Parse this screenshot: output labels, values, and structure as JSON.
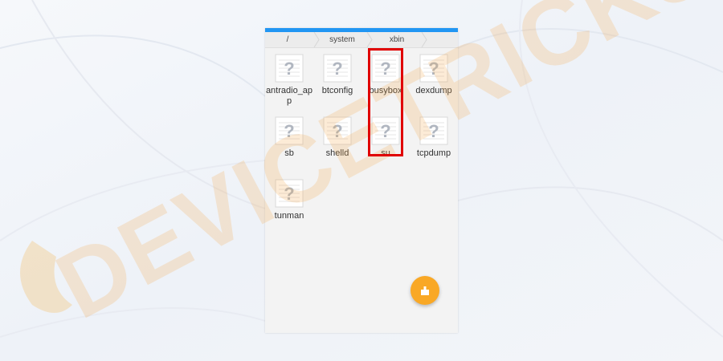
{
  "breadcrumb": [
    "/",
    "system",
    "xbin"
  ],
  "files": [
    {
      "name": "antradio_app",
      "icon": "unknown-file-icon"
    },
    {
      "name": "btconfig",
      "icon": "unknown-file-icon"
    },
    {
      "name": "busybox",
      "icon": "unknown-file-icon"
    },
    {
      "name": "dexdump",
      "icon": "unknown-file-icon"
    },
    {
      "name": "sb",
      "icon": "unknown-file-icon"
    },
    {
      "name": "shelld",
      "icon": "unknown-file-icon"
    },
    {
      "name": "su",
      "icon": "unknown-file-icon"
    },
    {
      "name": "tcpdump",
      "icon": "unknown-file-icon"
    },
    {
      "name": "tunman",
      "icon": "unknown-file-icon"
    }
  ],
  "highlighted": [
    "busybox",
    "su"
  ],
  "fab": {
    "icon": "clean-broom-icon"
  },
  "watermark": {
    "text": "DEVICETRICKS"
  },
  "colors": {
    "accent": "#2196f3",
    "fab": "#f9a825",
    "highlight": "#e00000",
    "watermark": "#f5c07a"
  }
}
